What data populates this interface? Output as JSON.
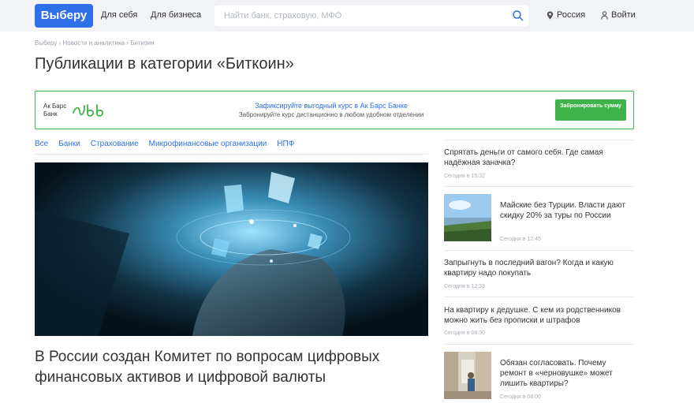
{
  "header": {
    "logo": "Выберу",
    "nav": [
      "Для себя",
      "Для бизнеса"
    ],
    "search_placeholder": "Найти банк, страховую, МФО",
    "region": "Россия",
    "login": "Войти"
  },
  "breadcrumb": [
    "Выберу",
    "Новости и аналитика",
    "Биткоин"
  ],
  "page_title": "Публикации в категории «Биткоин»",
  "banner": {
    "bank_name": "Ак Барс Банк",
    "title": "Зафиксируйте выгодный курс в Ак Барс Банке",
    "subtitle": "Забронируйте курс дистанционно в любом удобном отделении",
    "button": "Забронировать сумму",
    "accent_color": "#3fb24a"
  },
  "tabs": [
    "Все",
    "Банки",
    "Страхование",
    "Микрофинансовые организации",
    "НПФ"
  ],
  "main_article": {
    "title": "В России создан Комитет по вопросам цифровых финансовых активов и цифровой валюты"
  },
  "sidebar": [
    {
      "title": "Спрятать деньги от самого себя. Где самая надёжная заначка?",
      "time": "Сегодня в 15:32"
    },
    {
      "title": "Майские без Турции. Власти дают скидку 20% за туры по России",
      "time": "Сегодня в 12:45"
    },
    {
      "title": "Запрыгнуть в последний вагон? Когда и какую квартиру надо покупать",
      "time": "Сегодня в 12:33"
    },
    {
      "title": "На квартиру к дедушке. С кем из родственников можно жить без прописки и штрафов",
      "time": "Сегодня в 08:30"
    },
    {
      "title": "Обязан согласовать. Почему ремонт в «черновушке» может лишить квартиры?",
      "time": "Сегодня в 08:00"
    }
  ],
  "colors": {
    "brand": "#2f6fe8",
    "header_bg": "#f1f3f7"
  }
}
